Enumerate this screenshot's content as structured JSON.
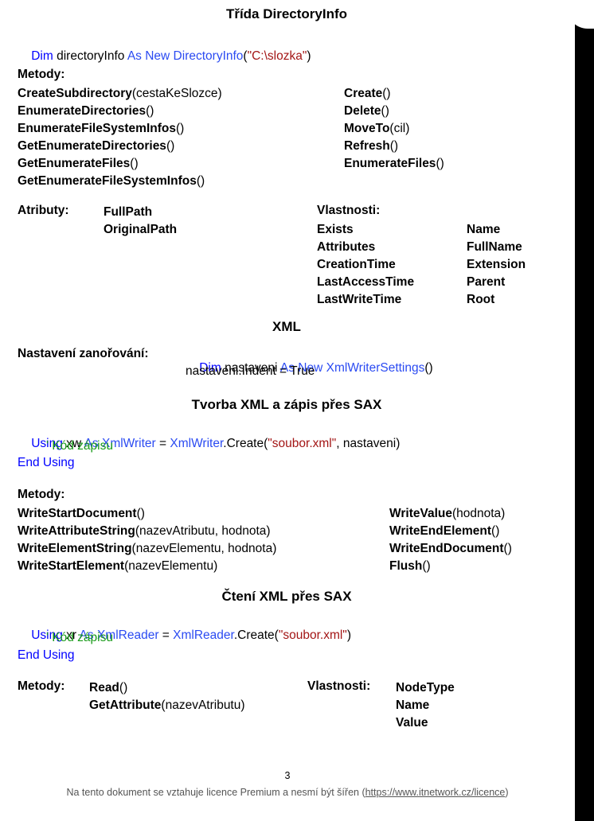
{
  "page": {
    "page_number": "3",
    "footer_note_prefix": "Na tento dokument se vztahuje licence Premium a nesmí být šířen (",
    "footer_link": "https://www.itnetwork.cz/licence",
    "footer_note_suffix": ")"
  },
  "colors": {
    "keyword": "#0000ff",
    "type": "#2b4bf2",
    "string": "#a31515",
    "comment": "#1a9b1a",
    "text": "#000000",
    "footer": "#555555",
    "edge_band": "#000000"
  },
  "sections": {
    "directoryinfo": {
      "title": "Třída DirectoryInfo",
      "declaration": {
        "kw1": "Dim",
        "var": " directoryInfo ",
        "kw2": "As New",
        "type": " DirectoryInfo",
        "paren_open": "(",
        "string": "\"C:\\slozka\"",
        "paren_close": ")"
      },
      "methods_label": "Metody:",
      "methods_left": [
        {
          "name": "CreateSubdirectory",
          "args": "(cestaKeSlozce)"
        },
        {
          "name": "EnumerateDirectories",
          "args": "()"
        },
        {
          "name": "EnumerateFileSystemInfos",
          "args": "()"
        },
        {
          "name": "GetEnumerateDirectories",
          "args": "()"
        },
        {
          "name": "GetEnumerateFiles",
          "args": "()"
        },
        {
          "name": "GetEnumerateFileSystemInfos",
          "args": "()"
        }
      ],
      "methods_right": [
        {
          "name": "Create",
          "args": "()"
        },
        {
          "name": "Delete",
          "args": "()"
        },
        {
          "name": "MoveTo",
          "args": "(cil)"
        },
        {
          "name": "Refresh",
          "args": "()"
        },
        {
          "name": "EnumerateFiles",
          "args": "()"
        }
      ],
      "attributes_label": "Atributy:",
      "attributes": [
        "FullPath",
        "OriginalPath"
      ],
      "properties_label": "Vlastnosti:",
      "properties_col1": [
        "Exists",
        "Attributes",
        "CreationTime",
        "LastAccessTime",
        "LastWriteTime"
      ],
      "properties_col2": [
        "Name",
        "FullName",
        "Extension",
        "Parent",
        "Root"
      ]
    },
    "xml": {
      "title": "XML",
      "nesting_label": "Nastavení zanořování:",
      "nesting_code_line1": {
        "kw1": "Dim",
        "var": " nastaveni ",
        "kw2": "As New",
        "type": " XmlWriterSettings",
        "parens": "()"
      },
      "nesting_code_line2": "nastaveni.Indent = True"
    },
    "write_sax": {
      "title": "Tvorba XML a zápis přes SAX",
      "code": {
        "kw_using": "Using",
        "var": " xw ",
        "kw_as": "As",
        "type1": " XmlWriter",
        "eq": " = ",
        "type2": "XmlWriter",
        "dot_create": ".Create(",
        "string": "\"soubor.xml\"",
        "rest": ", nastaveni)",
        "comment": "' Kód zápisu",
        "kw_end": "End Using"
      },
      "methods_label": "Metody:",
      "methods_left": [
        {
          "name": "WriteStartDocument",
          "args": "()"
        },
        {
          "name": "WriteAttributeString",
          "args": "(nazevAtributu, hodnota)"
        },
        {
          "name": "WriteElementString",
          "args": "(nazevElementu, hodnota)"
        },
        {
          "name": "WriteStartElement",
          "args": "(nazevElementu)"
        }
      ],
      "methods_right": [
        {
          "name": "WriteValue",
          "args": "(hodnota)"
        },
        {
          "name": "WriteEndElement",
          "args": "()"
        },
        {
          "name": "WriteEndDocument",
          "args": "()"
        },
        {
          "name": "Flush",
          "args": "()"
        }
      ]
    },
    "read_sax": {
      "title": "Čtení XML přes SAX",
      "code": {
        "kw_using": "Using",
        "var": " xr ",
        "kw_as": "As",
        "type1": " XmlReader",
        "eq": " = ",
        "type2": "XmlReader",
        "dot_create": ".Create(",
        "string": "\"soubor.xml\"",
        "rest": ")",
        "comment": "' Kód zápisu",
        "kw_end": "End Using"
      },
      "methods_label": "Metody:",
      "methods": [
        {
          "name": "Read",
          "args": "()"
        },
        {
          "name": "GetAttribute",
          "args": "(nazevAtributu)"
        }
      ],
      "properties_label": "Vlastnosti:",
      "properties": [
        "NodeType",
        "Name",
        "Value"
      ]
    }
  }
}
